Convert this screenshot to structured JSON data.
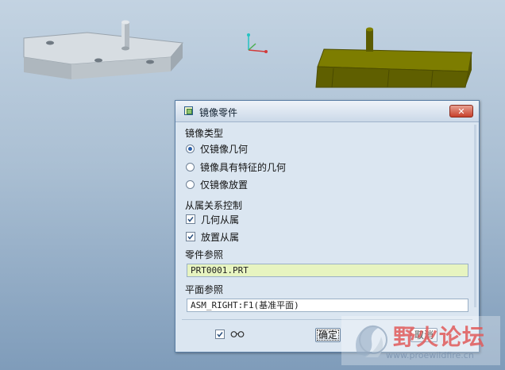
{
  "dialog": {
    "title": "镜像零件",
    "close_symbol": "✕",
    "mirror_type_label": "镜像类型",
    "mirror_options": [
      {
        "label": "仅镜像几何",
        "selected": true
      },
      {
        "label": "镜像具有特征的几何",
        "selected": false
      },
      {
        "label": "仅镜像放置",
        "selected": false
      }
    ],
    "dependency_label": "从属关系控制",
    "dependency_options": [
      {
        "label": "几何从属",
        "checked": true
      },
      {
        "label": "放置从属",
        "checked": true
      }
    ],
    "part_ref_label": "零件参照",
    "part_ref_value": "PRT0001.PRT",
    "plane_ref_label": "平面参照",
    "plane_ref_value": "ASM_RIGHT:F1(基准平面)",
    "preview_icon": "glasses-icon",
    "ok_label": "确定",
    "cancel_label": "取消"
  },
  "watermark": {
    "title": "野火论坛",
    "url": "www.proewildfire.cn"
  },
  "colors": {
    "field_green": "#e7f4c0",
    "mirrored_part": "#6b6b00",
    "original_part": "#c3cbd1"
  }
}
